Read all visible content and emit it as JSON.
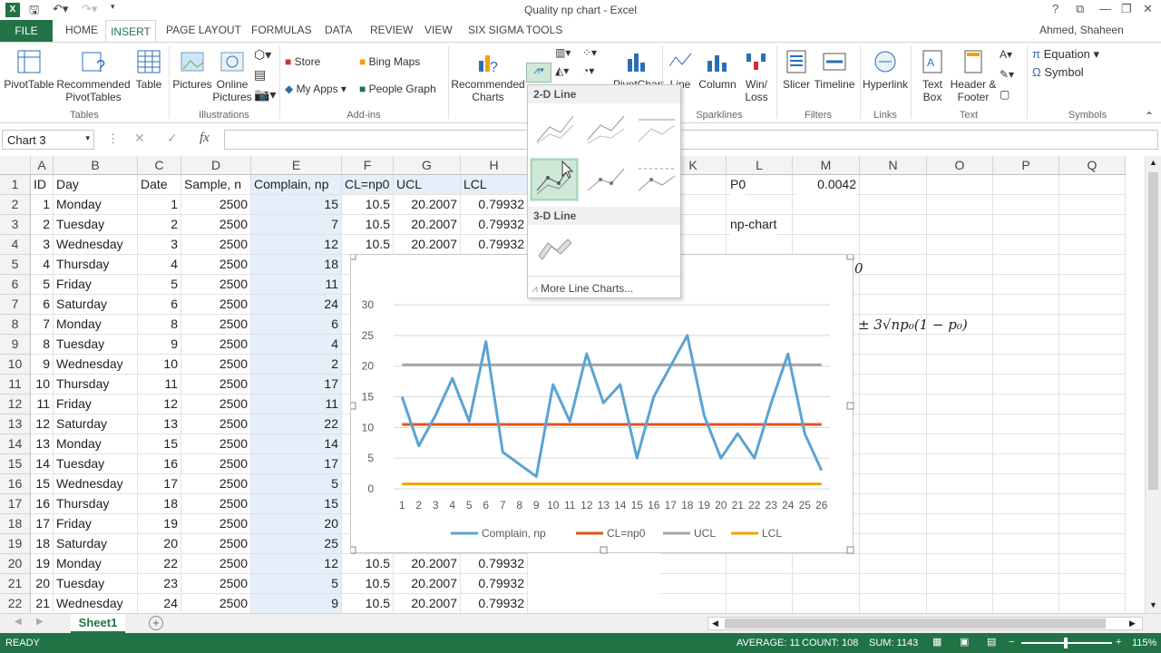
{
  "window": {
    "title": "Quality np chart - Excel",
    "user": "Ahmed, Shaheen",
    "help": "?"
  },
  "qat": {
    "excel_icon": "excel-icon",
    "save_icon": "save-icon",
    "undo_icon": "undo-icon",
    "redo_icon": "redo-icon"
  },
  "tabs": [
    "FILE",
    "HOME",
    "INSERT",
    "PAGE LAYOUT",
    "FORMULAS",
    "DATA",
    "REVIEW",
    "VIEW",
    "SIX SIGMA TOOLS"
  ],
  "ribbon": {
    "pivottable": "PivotTable",
    "recommended_pivot": "Recommended PivotTables",
    "table": "Table",
    "pictures": "Pictures",
    "online_pictures": "Online Pictures",
    "store": "Store",
    "my_apps": "My Apps",
    "bing_maps": "Bing Maps",
    "people_graph": "People Graph",
    "recommended_charts": "Recommended Charts",
    "pivotchart": "PivotChart",
    "line": "Line",
    "column": "Column",
    "winloss": "Win/ Loss",
    "slicer": "Slicer",
    "timeline": "Timeline",
    "hyperlink": "Hyperlink",
    "text_box": "Text Box",
    "header_footer": "Header & Footer",
    "equation": "Equation",
    "symbol": "Symbol",
    "groups": {
      "tables": "Tables",
      "illustrations": "Illustrations",
      "addins": "Add-ins",
      "sparklines": "Sparklines",
      "filters": "Filters",
      "links": "Links",
      "text": "Text",
      "symbols": "Symbols"
    }
  },
  "formula": {
    "namebox": "Chart 3",
    "fx": "fx"
  },
  "columns": [
    "A",
    "B",
    "C",
    "D",
    "E",
    "F",
    "G",
    "H",
    "K",
    "L",
    "M",
    "N",
    "O",
    "P",
    "Q"
  ],
  "header_row": [
    "ID",
    "Day",
    "Date",
    "Sample, n",
    "Complain, np",
    "CL=np0",
    "UCL",
    "LCL"
  ],
  "rows": [
    [
      "1",
      "Monday",
      "1",
      "2500",
      "15",
      "10.5",
      "20.2007",
      "0.79932"
    ],
    [
      "2",
      "Tuesday",
      "2",
      "2500",
      "7",
      "10.5",
      "20.2007",
      "0.79932"
    ],
    [
      "3",
      "Wednesday",
      "3",
      "2500",
      "12",
      "10.5",
      "20.2007",
      "0.79932"
    ],
    [
      "4",
      "Thursday",
      "4",
      "2500",
      "18",
      "",
      "",
      ""
    ],
    [
      "5",
      "Friday",
      "5",
      "2500",
      "11",
      "",
      "",
      ""
    ],
    [
      "6",
      "Saturday",
      "6",
      "2500",
      "24",
      "",
      "",
      ""
    ],
    [
      "7",
      "Monday",
      "8",
      "2500",
      "6",
      "",
      "",
      ""
    ],
    [
      "8",
      "Tuesday",
      "9",
      "2500",
      "4",
      "",
      "",
      ""
    ],
    [
      "9",
      "Wednesday",
      "10",
      "2500",
      "2",
      "",
      "",
      ""
    ],
    [
      "10",
      "Thursday",
      "11",
      "2500",
      "17",
      "",
      "",
      ""
    ],
    [
      "11",
      "Friday",
      "12",
      "2500",
      "11",
      "",
      "",
      ""
    ],
    [
      "12",
      "Saturday",
      "13",
      "2500",
      "22",
      "",
      "",
      ""
    ],
    [
      "13",
      "Monday",
      "15",
      "2500",
      "14",
      "",
      "",
      ""
    ],
    [
      "14",
      "Tuesday",
      "16",
      "2500",
      "17",
      "",
      "",
      ""
    ],
    [
      "15",
      "Wednesday",
      "17",
      "2500",
      "5",
      "",
      "",
      ""
    ],
    [
      "16",
      "Thursday",
      "18",
      "2500",
      "15",
      "",
      "",
      ""
    ],
    [
      "17",
      "Friday",
      "19",
      "2500",
      "20",
      "",
      "",
      ""
    ],
    [
      "18",
      "Saturday",
      "20",
      "2500",
      "25",
      "",
      "",
      ""
    ],
    [
      "19",
      "Monday",
      "22",
      "2500",
      "12",
      "10.5",
      "20.2007",
      "0.79932"
    ],
    [
      "20",
      "Tuesday",
      "23",
      "2500",
      "5",
      "10.5",
      "20.2007",
      "0.79932"
    ],
    [
      "21",
      "Wednesday",
      "24",
      "2500",
      "9",
      "10.5",
      "20.2007",
      "0.79932"
    ]
  ],
  "side_cells": {
    "l1": "P0",
    "m1": "0.0042",
    "l3": "np-chart",
    "formula_frag1": "0",
    "formula_frag2": "± 3√np₀(1 − p₀)"
  },
  "dropdown": {
    "section1": "2-D Line",
    "section2": "3-D Line",
    "more": "More Line Charts..."
  },
  "chart_data": {
    "type": "line",
    "x": [
      1,
      2,
      3,
      4,
      5,
      6,
      7,
      8,
      9,
      10,
      11,
      12,
      13,
      14,
      15,
      16,
      17,
      18,
      19,
      20,
      21,
      22,
      23,
      24,
      25,
      26
    ],
    "ylim": [
      0,
      30
    ],
    "yticks": [
      "0",
      "5",
      "10",
      "15",
      "20",
      "25",
      "30"
    ],
    "series": [
      {
        "name": "Complain, np",
        "color": "#5ba3d3",
        "values": [
          15,
          7,
          12,
          18,
          11,
          24,
          6,
          4,
          2,
          17,
          11,
          22,
          14,
          17,
          5,
          15,
          20,
          25,
          12,
          5,
          9,
          5,
          14,
          22,
          9,
          3
        ]
      },
      {
        "name": "CL=np0",
        "color": "#e0531c",
        "values": [
          10.5,
          10.5,
          10.5,
          10.5,
          10.5,
          10.5,
          10.5,
          10.5,
          10.5,
          10.5,
          10.5,
          10.5,
          10.5,
          10.5,
          10.5,
          10.5,
          10.5,
          10.5,
          10.5,
          10.5,
          10.5,
          10.5,
          10.5,
          10.5,
          10.5,
          10.5
        ]
      },
      {
        "name": "UCL",
        "color": "#a5a5a5",
        "values": [
          20.2007,
          20.2007,
          20.2007,
          20.2007,
          20.2007,
          20.2007,
          20.2007,
          20.2007,
          20.2007,
          20.2007,
          20.2007,
          20.2007,
          20.2007,
          20.2007,
          20.2007,
          20.2007,
          20.2007,
          20.2007,
          20.2007,
          20.2007,
          20.2007,
          20.2007,
          20.2007,
          20.2007,
          20.2007,
          20.2007
        ]
      },
      {
        "name": "LCL",
        "color": "#f0a30a",
        "values": [
          0.79932,
          0.79932,
          0.79932,
          0.79932,
          0.79932,
          0.79932,
          0.79932,
          0.79932,
          0.79932,
          0.79932,
          0.79932,
          0.79932,
          0.79932,
          0.79932,
          0.79932,
          0.79932,
          0.79932,
          0.79932,
          0.79932,
          0.79932,
          0.79932,
          0.79932,
          0.79932,
          0.79932,
          0.79932,
          0.79932
        ]
      }
    ],
    "legend": "bottom",
    "grid": true
  },
  "sheet": {
    "name": "Sheet1",
    "add": "+"
  },
  "status": {
    "ready": "READY",
    "average": "AVERAGE: 11",
    "count": "COUNT: 108",
    "sum": "SUM: 1143",
    "zoom": "115%"
  }
}
